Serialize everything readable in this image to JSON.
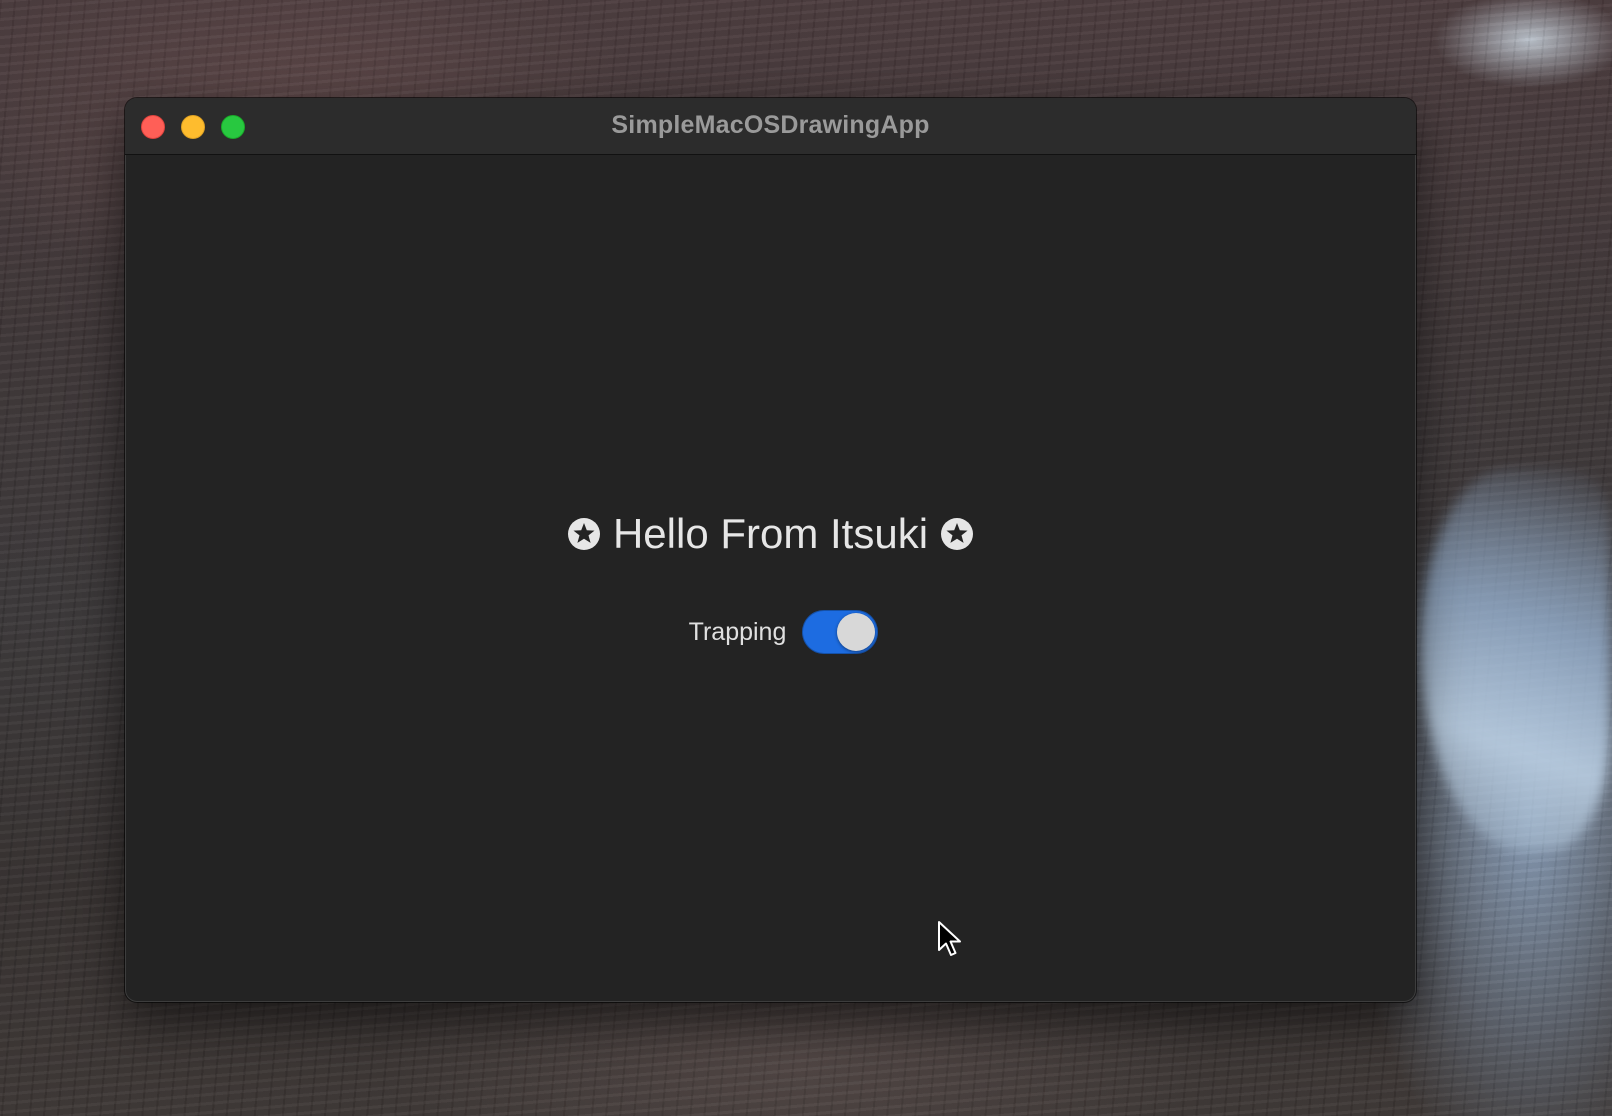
{
  "window": {
    "title": "SimpleMacOSDrawingApp",
    "traffic_lights": {
      "close": "#ff5f57",
      "minimize": "#febc2e",
      "zoom": "#28c840"
    }
  },
  "main": {
    "headline": "Hello From Itsuki",
    "headline_icons": [
      "star-circle-icon",
      "star-circle-icon"
    ],
    "toggle": {
      "label": "Trapping",
      "state": "on",
      "accent_color": "#1d6ce1"
    }
  },
  "colors": {
    "window_background": "#232323",
    "titlebar_background": "#2c2c2c",
    "title_text": "#9a9a9a",
    "body_text": "#e6e6e6"
  },
  "cursor_icon": "arrow-pointer-icon"
}
